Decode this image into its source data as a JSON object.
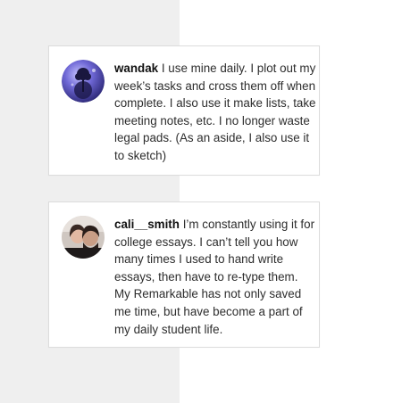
{
  "comments": [
    {
      "username": "wandak",
      "text": "I use mine daily. I plot out my week’s tasks and cross them off when complete. I also use it make lists, take meeting notes, etc. I no longer waste legal pads. (As an aside, I also use it to sketch)",
      "avatar": "planet-tree-avatar"
    },
    {
      "username": "cali__smith",
      "text": "I’m constantly using it for college essays. I can’t tell you how many times I used to hand write essays, then have to re-type them. My Remarkable has not only saved me time, but have become a part of my daily student life.",
      "avatar": "couple-photo-avatar"
    }
  ],
  "colors": {
    "left_panel": "#efefef",
    "card_border": "#dcdcdc",
    "text": "#2d2d2d"
  }
}
